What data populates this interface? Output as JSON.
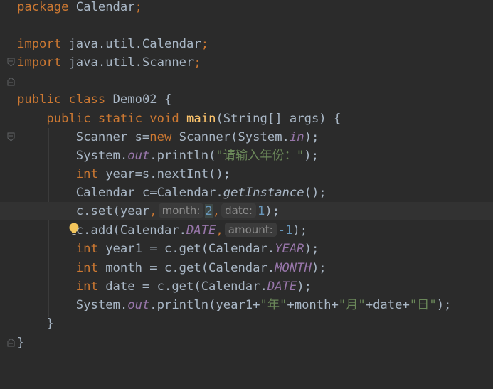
{
  "editor": {
    "lines": [
      {
        "package_kw": "package",
        "pkg_name": "Calendar",
        "semi": ";"
      },
      {},
      {
        "import_kw": "import",
        "path": "java.util.Calendar",
        "semi": ";"
      },
      {
        "import_kw": "import",
        "path": "java.util.Scanner",
        "semi": ";"
      },
      {},
      {
        "public_kw": "public",
        "class_kw": "class",
        "class_name": "Demo02 {"
      },
      {
        "mods": "public static void",
        "method": "main",
        "rest": "(String[] args) {"
      },
      {
        "a": "Scanner s=",
        "new_kw": "new",
        "b": " Scanner(System.",
        "field": "in",
        "c": ");"
      },
      {
        "a": "System.",
        "field": "out",
        "b": ".println(",
        "str": "\"请输入年份：\"",
        "c": ");"
      },
      {
        "type": "int",
        "rest": " year=s.nextInt();"
      },
      {
        "a": "Calendar c=Calendar.",
        "static_method": "getInstance",
        "b": "();"
      },
      {
        "a": "c.set(year",
        "c1": ",",
        "hint_month": "month:",
        "num1": "2",
        "c2": ",",
        "hint_date": "date:",
        "num2": "1",
        "b": ");"
      },
      {
        "a": "c.add(Calendar.",
        "field": "DATE",
        "c1": ",",
        "hint_amount": "amount:",
        "num": "-1",
        "b": ");"
      },
      {
        "type": "int",
        "a": " year1 = c.get(Calendar.",
        "field": "YEAR",
        "b": ");"
      },
      {
        "type": "int",
        "a": " month = c.get(Calendar.",
        "field": "MONTH",
        "b": ");"
      },
      {
        "type": "int",
        "a": " date = c.get(Calendar.",
        "field": "DATE",
        "b": ");"
      },
      {
        "a": "System.",
        "field": "out",
        "b": ".println(year1+",
        "s1": "\"年\"",
        "c": "+month+",
        "s2": "\"月\"",
        "d": "+date+",
        "s3": "\"日\"",
        "e": ");"
      },
      {
        "brace": "}"
      },
      {
        "brace": "}"
      }
    ]
  },
  "colors": {
    "background": "#2b2b2b",
    "keyword": "#cc7832",
    "string": "#6a8759",
    "number": "#6897bb",
    "field": "#9876aa",
    "method": "#ffc66d",
    "text": "#a9b7c6"
  },
  "icons": [
    "fold-marker-icon",
    "lightbulb-icon"
  ]
}
